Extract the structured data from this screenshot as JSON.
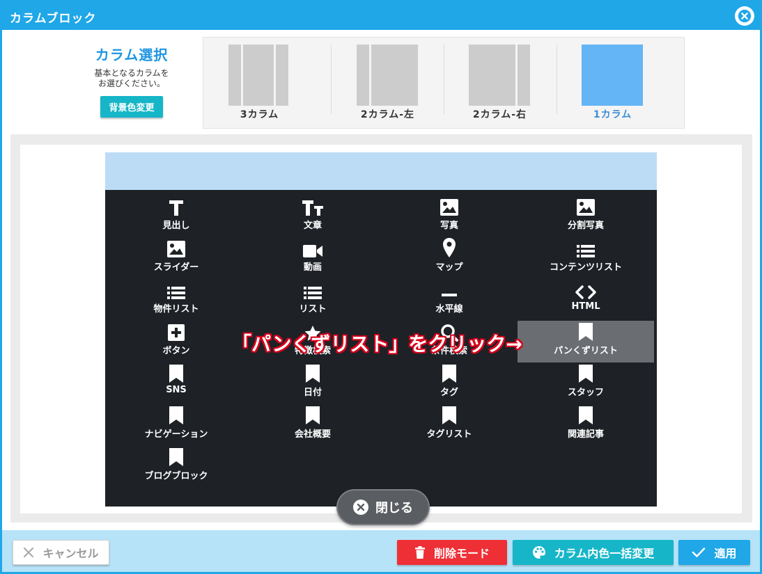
{
  "window": {
    "title": "カラムブロック"
  },
  "column_select": {
    "title": "カラム選択",
    "desc_line1": "基本となるカラムを",
    "desc_line2": "お選びください。",
    "bg_color_button": "背景色変更",
    "options": [
      {
        "label": "3カラム",
        "selected": false
      },
      {
        "label": "2カラム-左",
        "selected": false
      },
      {
        "label": "2カラム-右",
        "selected": false
      },
      {
        "label": "1カラム",
        "selected": true
      }
    ]
  },
  "palette": {
    "items": [
      {
        "label": "見出し",
        "icon": "heading-icon"
      },
      {
        "label": "文章",
        "icon": "text-size-icon"
      },
      {
        "label": "写真",
        "icon": "image-icon"
      },
      {
        "label": "分割写真",
        "icon": "image-icon"
      },
      {
        "label": "スライダー",
        "icon": "image-icon"
      },
      {
        "label": "動画",
        "icon": "video-icon"
      },
      {
        "label": "マップ",
        "icon": "map-marker-icon"
      },
      {
        "label": "コンテンツリスト",
        "icon": "list-icon"
      },
      {
        "label": "物件リスト",
        "icon": "list-icon"
      },
      {
        "label": "リスト",
        "icon": "list-icon"
      },
      {
        "label": "水平線",
        "icon": "minus-icon"
      },
      {
        "label": "HTML",
        "icon": "code-icon"
      },
      {
        "label": "ボタン",
        "icon": "plus-square-icon"
      },
      {
        "label": "特徴検索",
        "icon": "star-icon"
      },
      {
        "label": "条件検索",
        "icon": "search-icon"
      },
      {
        "label": "パンくずリスト",
        "icon": "bookmark-icon",
        "highlighted": true
      },
      {
        "label": "SNS",
        "icon": "bookmark-icon"
      },
      {
        "label": "日付",
        "icon": "bookmark-icon"
      },
      {
        "label": "タグ",
        "icon": "bookmark-icon"
      },
      {
        "label": "スタッフ",
        "icon": "bookmark-icon"
      },
      {
        "label": "ナビゲーション",
        "icon": "bookmark-icon"
      },
      {
        "label": "会社概要",
        "icon": "bookmark-icon"
      },
      {
        "label": "タグリスト",
        "icon": "bookmark-icon"
      },
      {
        "label": "関連記事",
        "icon": "bookmark-icon"
      },
      {
        "label": "ブログブロック",
        "icon": "bookmark-icon"
      }
    ]
  },
  "annotation": "「パンくずリスト」をクリック→",
  "close_palette": "閉じる",
  "footer": {
    "cancel": "キャンセル",
    "delete_mode": "削除モード",
    "column_color": "カラム内色一括変更",
    "apply": "適用"
  },
  "colors": {
    "accent": "#1fa7e8",
    "teal": "#16b6c8",
    "danger": "#ef2f36",
    "palette_bg": "#1e2227",
    "selected_layout": "#64b5f6"
  }
}
